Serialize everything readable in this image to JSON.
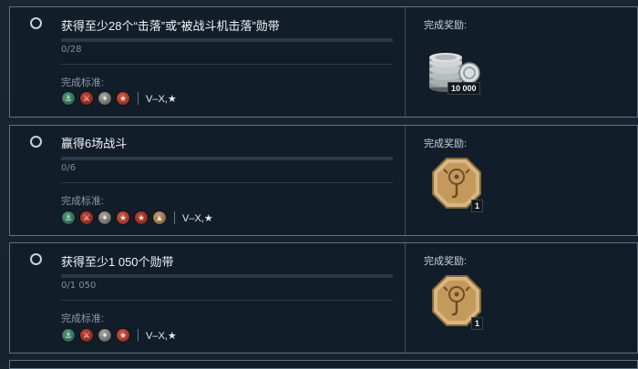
{
  "missions": [
    {
      "title": "获得至少28个“击落”或“被战斗机击落”勋带",
      "progress_text": "0/28",
      "progress_fraction": 0,
      "criteria_label": "完成标准:",
      "criteria_icons": [
        "submarine-icon",
        "destroyer-icon",
        "cruiser-icon",
        "battleship-icon"
      ],
      "tier_text": "V–X,★",
      "reward_label": "完成奖励:",
      "reward_icon": "credits-icon",
      "reward_amount": "10 000"
    },
    {
      "title": "赢得6场战斗",
      "progress_text": "0/6",
      "progress_fraction": 0,
      "criteria_label": "完成标准:",
      "criteria_icons": [
        "submarine-icon",
        "destroyer-icon",
        "cruiser-icon",
        "battleship-icon",
        "aircraft-carrier-icon",
        "ship-icon"
      ],
      "tier_text": "V–X,★",
      "reward_label": "完成奖励:",
      "reward_icon": "container-token-icon",
      "reward_amount": "1"
    },
    {
      "title": "获得至少1 050个勋带",
      "progress_text": "0/1 050",
      "progress_fraction": 0,
      "criteria_label": "完成标准:",
      "criteria_icons": [
        "submarine-icon",
        "destroyer-icon",
        "cruiser-icon",
        "battleship-icon"
      ],
      "tier_text": "V–X,★",
      "reward_label": "完成奖励:",
      "reward_icon": "container-token-icon",
      "reward_amount": "1"
    }
  ],
  "colors": {
    "background": "#172430",
    "card_border": "#5f7384",
    "token_gold": "#c49a5c"
  }
}
